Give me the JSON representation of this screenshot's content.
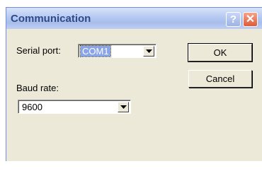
{
  "dialog": {
    "title": "Communication",
    "help_glyph": "?",
    "close_glyph": "✕"
  },
  "serial_port": {
    "label": "Serial port:",
    "value": "COM1"
  },
  "baud_rate": {
    "label": "Baud rate:",
    "value": "9600"
  },
  "buttons": {
    "ok": "OK",
    "cancel": "Cancel"
  },
  "icons": {
    "help": "question-mark-icon",
    "close": "close-x-icon",
    "dropdown": "chevron-down-icon"
  }
}
